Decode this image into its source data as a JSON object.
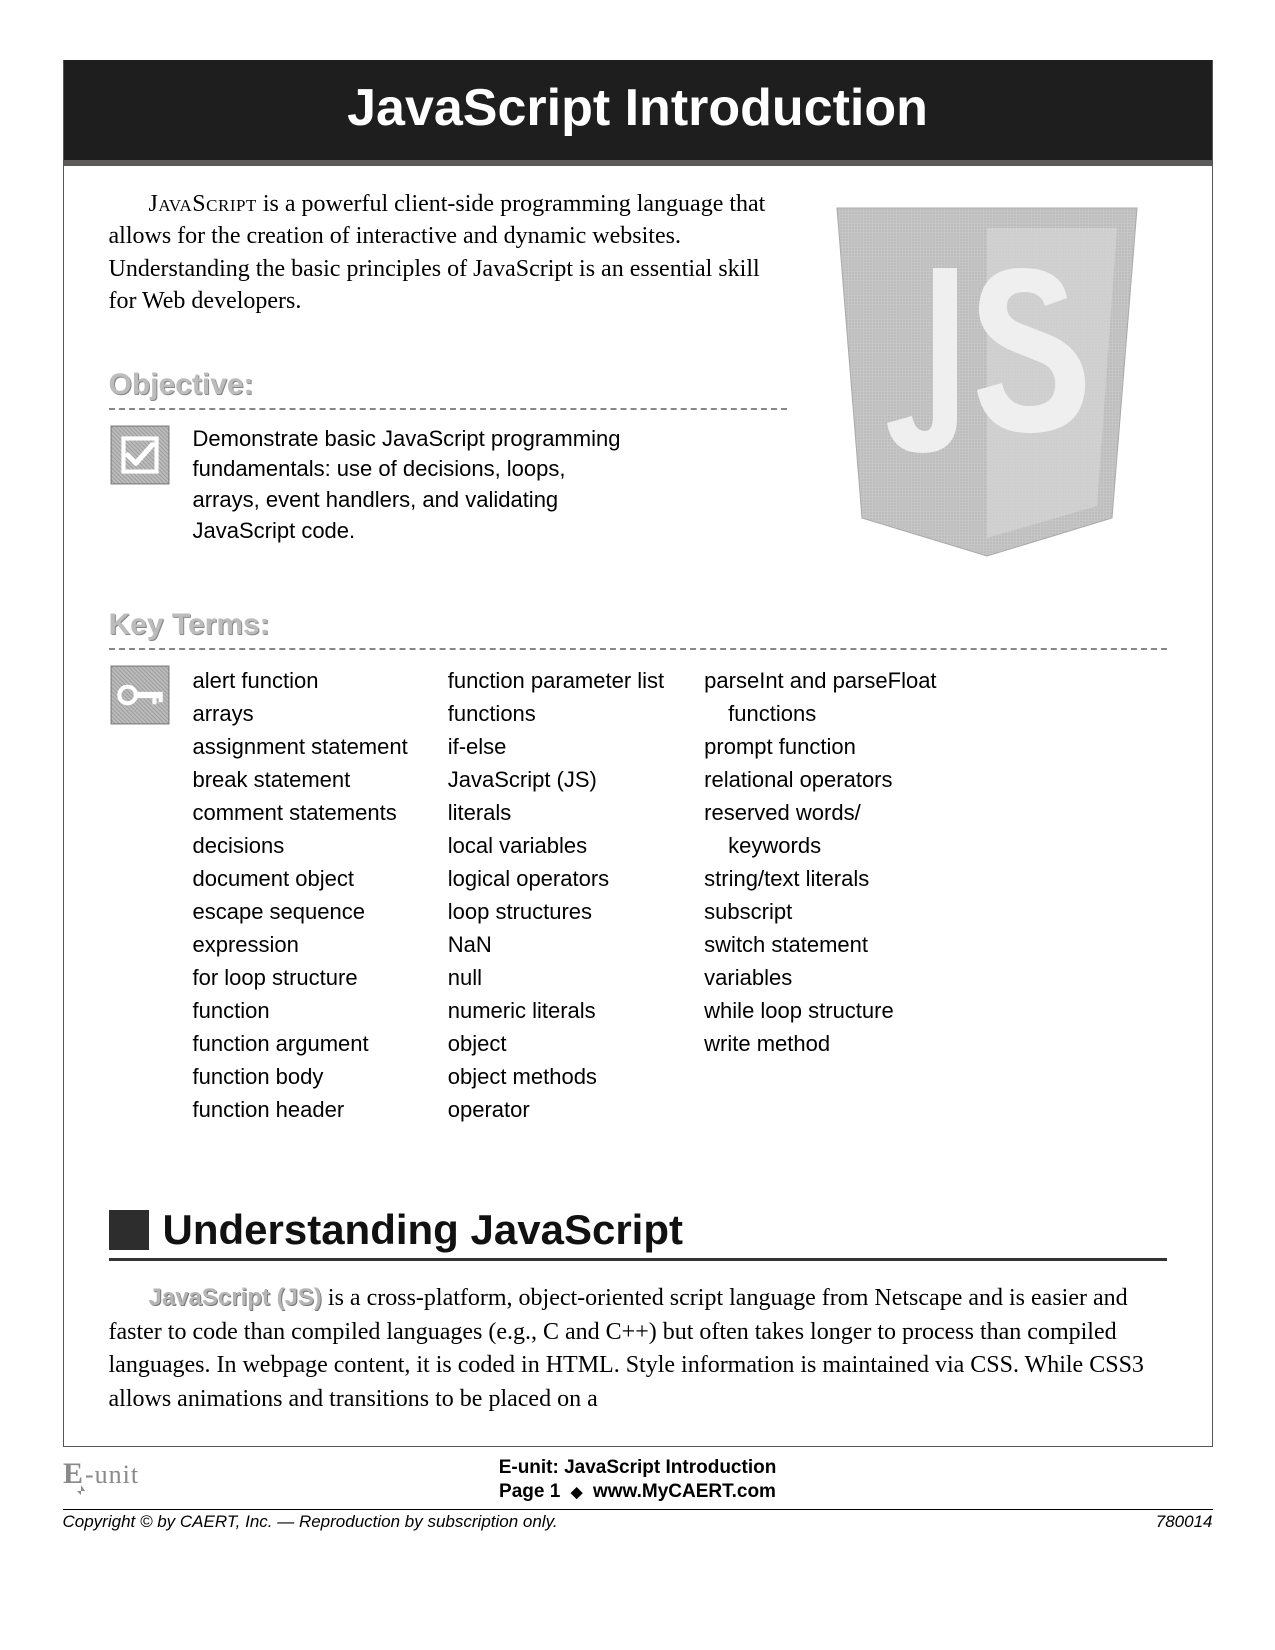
{
  "title": "JavaScript Introduction",
  "intro_sc": "JavaScript",
  "intro_rest": " is a powerful client-side programming language that allows for the creation of interactive and dynamic websites. Understanding the basic principles of JavaScript is an essential skill for Web developers.",
  "objective": {
    "heading": "Objective:",
    "text": "Demonstrate basic JavaScript programming fundamentals: use of decisions, loops, arrays, event handlers, and validating JavaScript code."
  },
  "key_terms": {
    "heading": "Key Terms:",
    "columns": [
      [
        "alert function",
        "arrays",
        "assignment statement",
        "break statement",
        "comment statements",
        "decisions",
        "document object",
        "escape sequence",
        "expression",
        "for loop structure",
        "function",
        "function argument",
        "function body",
        "function header"
      ],
      [
        "function parameter list",
        "functions",
        "if-else",
        "JavaScript (JS)",
        "literals",
        "local variables",
        "logical operators",
        "loop structures",
        "NaN",
        "null",
        "numeric literals",
        "object",
        "object methods",
        "operator"
      ],
      [
        "parseInt and parseFloat",
        "functions",
        "prompt function",
        "relational operators",
        "reserved words/",
        "keywords",
        "string/text literals",
        "subscript",
        "switch statement",
        "variables",
        "while loop structure",
        "write method"
      ]
    ],
    "indent_map": {
      "2": [
        1,
        5
      ]
    }
  },
  "section2": {
    "heading": "Understanding JavaScript",
    "bold_lead": "JavaScript (JS)",
    "body": " is a cross-platform, object-oriented script language from Netscape and is easier and faster to code than compiled languages (e.g., C and C++) but often takes longer to process than compiled languages. In webpage content, it is coded in HTML. Style information is maintained via CSS. While CSS3 allows animations and transitions to be placed on a"
  },
  "footer": {
    "unit": "E-unit: JavaScript Introduction",
    "page_label": "Page",
    "page_num": "1",
    "site": "www.MyCAERT.com",
    "copyright": "Copyright © by CAERT, Inc. — Reproduction by subscription only.",
    "code": "780014",
    "logo_text": "E-unit"
  }
}
